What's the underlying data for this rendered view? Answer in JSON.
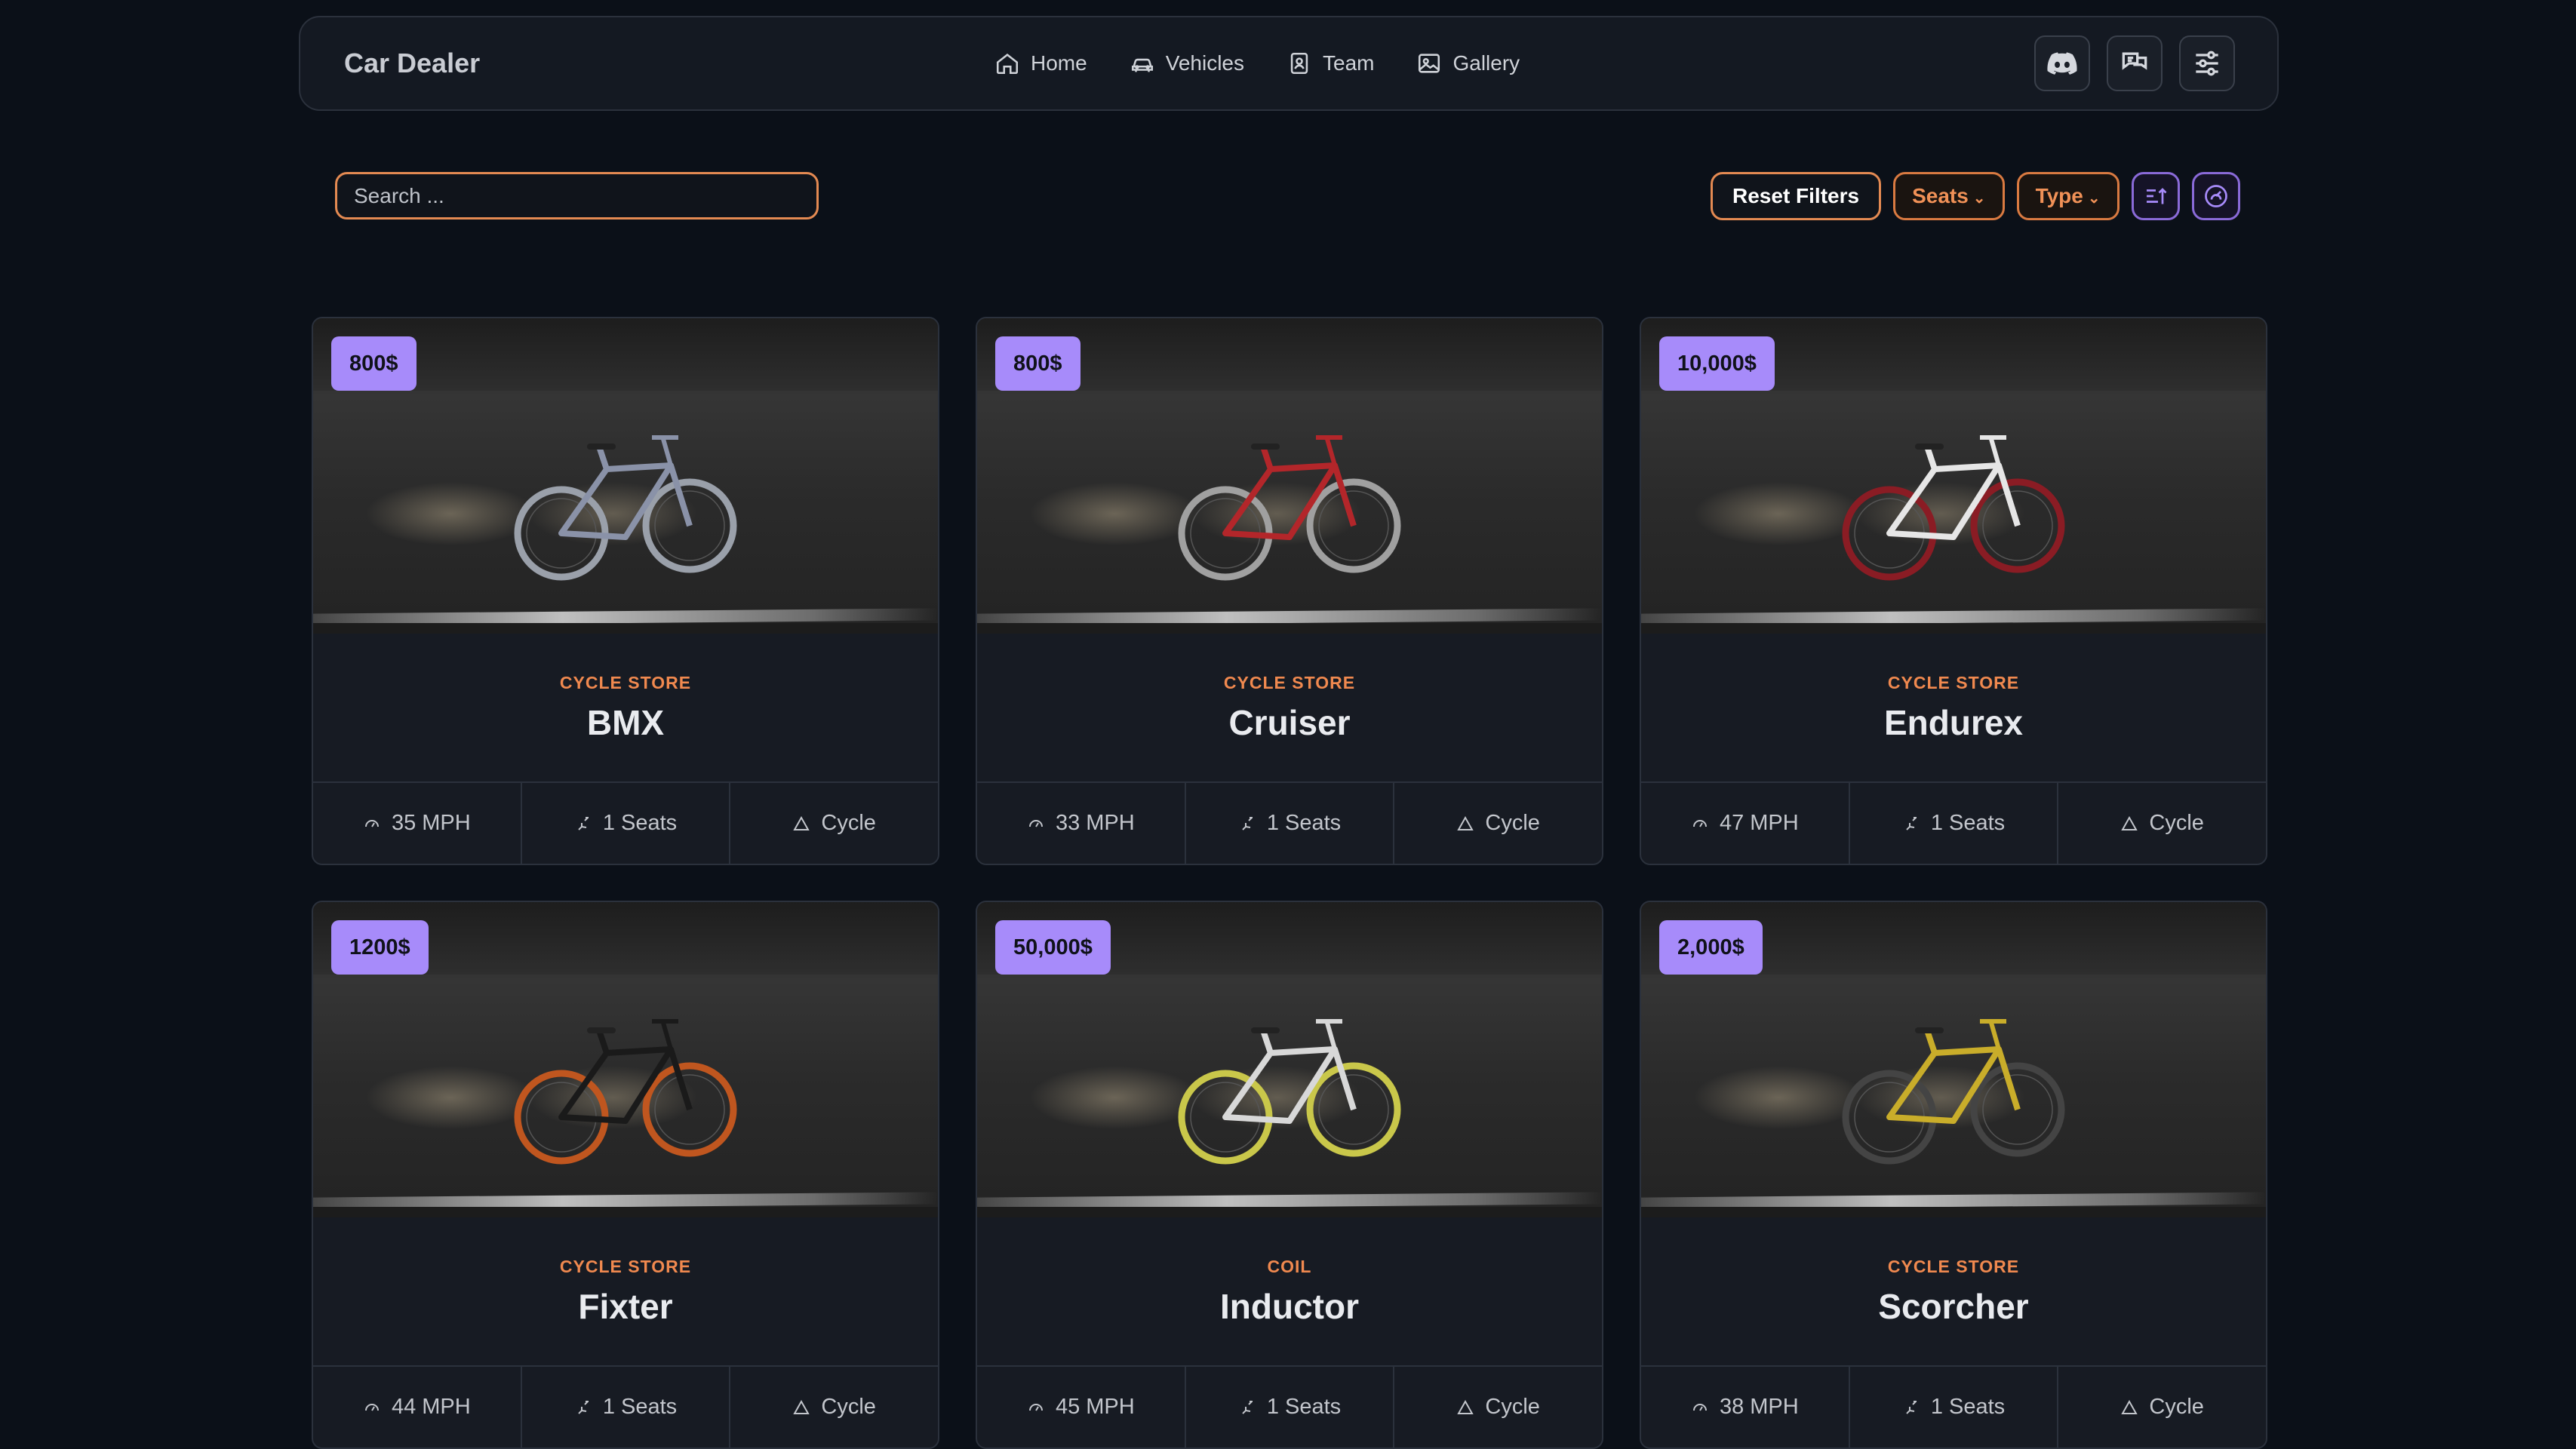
{
  "navbar": {
    "brand": "Car Dealer",
    "links": [
      {
        "label": "Home",
        "icon": "home-icon"
      },
      {
        "label": "Vehicles",
        "icon": "car-icon"
      },
      {
        "label": "Team",
        "icon": "team-icon"
      },
      {
        "label": "Gallery",
        "icon": "gallery-icon"
      }
    ],
    "actions": [
      "discord-icon",
      "chat-icon",
      "sliders-icon"
    ]
  },
  "search": {
    "placeholder": "Search ..."
  },
  "filters": {
    "reset_label": "Reset Filters",
    "seats_label": "Seats",
    "type_label": "Type",
    "chevron": "⌄"
  },
  "colors": {
    "accent_orange": "#f0894f",
    "price_badge": "#a78bfa",
    "background": "#0b1018",
    "card": "#171b23"
  },
  "vehicles": [
    {
      "price": "800$",
      "brand": "CYCLE STORE",
      "model": "BMX",
      "speed": "35 MPH",
      "seats": "1 Seats",
      "type": "Cycle",
      "frame_color": "#8a92a8",
      "wheel_color": "#9aa0aa"
    },
    {
      "price": "800$",
      "brand": "CYCLE STORE",
      "model": "Cruiser",
      "speed": "33 MPH",
      "seats": "1 Seats",
      "type": "Cycle",
      "frame_color": "#b3262a",
      "wheel_color": "#a0a0a0"
    },
    {
      "price": "10,000$",
      "brand": "CYCLE STORE",
      "model": "Endurex",
      "speed": "47 MPH",
      "seats": "1 Seats",
      "type": "Cycle",
      "frame_color": "#e6e6e6",
      "wheel_color": "#8a1c24"
    },
    {
      "price": "1200$",
      "brand": "CYCLE STORE",
      "model": "Fixter",
      "speed": "44 MPH",
      "seats": "1 Seats",
      "type": "Cycle",
      "frame_color": "#1a1a1a",
      "wheel_color": "#c0561f"
    },
    {
      "price": "50,000$",
      "brand": "COIL",
      "model": "Inductor",
      "speed": "45 MPH",
      "seats": "1 Seats",
      "type": "Cycle",
      "frame_color": "#d8d8d8",
      "wheel_color": "#c9c74a"
    },
    {
      "price": "2,000$",
      "brand": "CYCLE STORE",
      "model": "Scorcher",
      "speed": "38 MPH",
      "seats": "1 Seats",
      "type": "Cycle",
      "frame_color": "#c9ad2a",
      "wheel_color": "#444444"
    }
  ]
}
